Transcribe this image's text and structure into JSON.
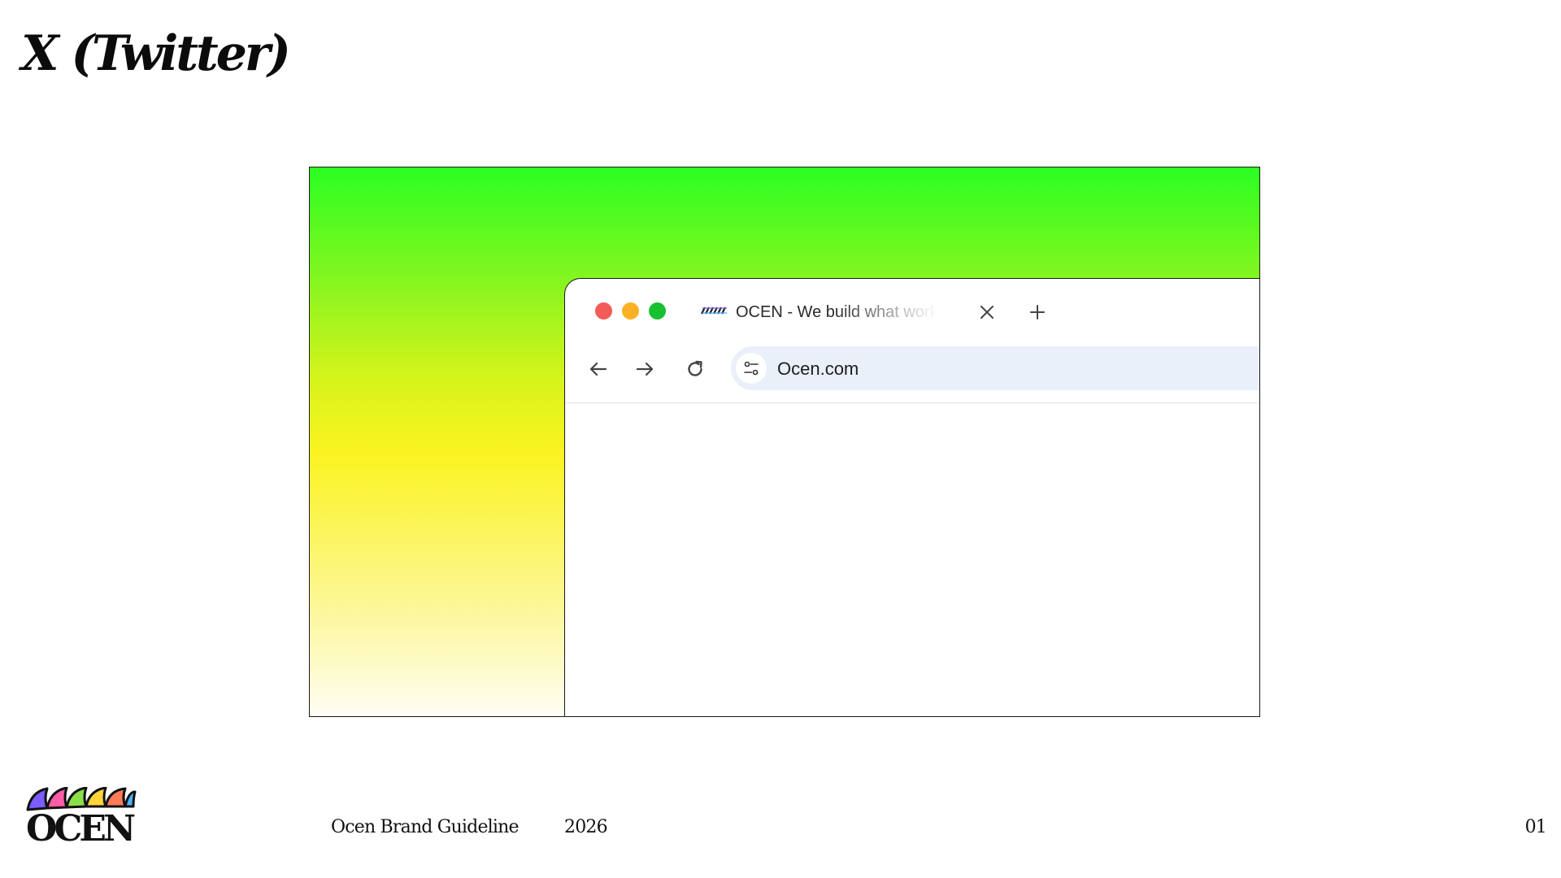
{
  "slide": {
    "title": "X (Twitter)"
  },
  "browser": {
    "tab": {
      "title": "OCEN - We build what works",
      "favicon": "ocen-logo-icon"
    },
    "address_bar": {
      "url": "Ocen.com"
    },
    "icons": {
      "close": "close-icon",
      "new_tab": "plus-icon",
      "back": "arrow-left-icon",
      "forward": "arrow-right-icon",
      "reload": "reload-icon",
      "site_settings": "sliders-icon"
    },
    "traffic_light_colors": [
      "#f35b57",
      "#fbb125",
      "#17c031"
    ]
  },
  "footer": {
    "logo_text": "OCEN",
    "guideline": "Ocen Brand Guideline",
    "year": "2026",
    "page_number": "01"
  },
  "colors": {
    "gradient_top": "#2bff22",
    "gradient_middle": "#fbf320",
    "gradient_bottom": "#fffdf3",
    "address_bar_bg": "#e9f0fa"
  }
}
